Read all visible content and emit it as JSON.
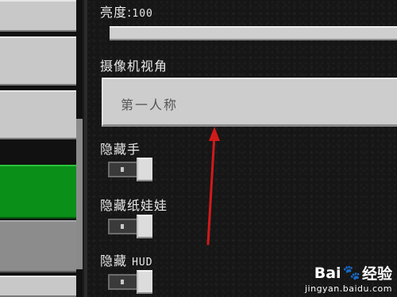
{
  "settings": {
    "brightness": {
      "label": "亮度:",
      "value": "100"
    },
    "camera": {
      "label": "摄像机视角",
      "selected": "第一人称"
    },
    "hide_hand": {
      "label": "隐藏手"
    },
    "hide_paper_doll": {
      "label": "隐藏纸娃娃"
    },
    "hide_hud": {
      "label_prefix": "隐藏",
      "label_suffix": "HUD"
    }
  },
  "sidebar": {
    "items": [
      {
        "state": "normal"
      },
      {
        "state": "normal"
      },
      {
        "state": "normal"
      },
      {
        "state": "selected"
      },
      {
        "state": "normal"
      },
      {
        "state": "normal"
      }
    ]
  },
  "watermark": {
    "brand_prefix": "Bai",
    "brand_suffix": "经验",
    "url": "jingyan.baidu.com"
  },
  "colors": {
    "selected": "#0a8f19",
    "annotation": "#d11a1a",
    "panel": "#cdcdcd"
  }
}
